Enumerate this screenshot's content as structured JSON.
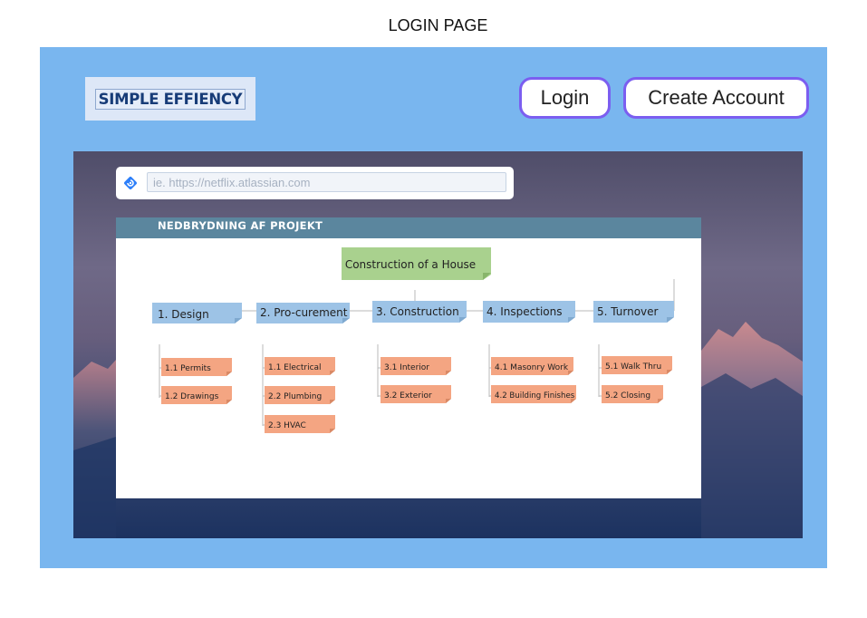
{
  "page": {
    "heading": "LOGIN PAGE"
  },
  "header": {
    "logo_text": "SIMPLE EFFIENCY",
    "login_label": "Login",
    "create_account_label": "Create Account"
  },
  "url_field": {
    "placeholder": "ie. https://netflix.atlassian.com",
    "value": ""
  },
  "document": {
    "title": "NEDBRYDNING AF PROJEKT",
    "root": "Construction of a House",
    "phases": [
      {
        "label": "1. Design",
        "tasks": [
          "1.1 Permits",
          "1.2 Drawings"
        ]
      },
      {
        "label": "2. Pro-curement",
        "tasks": [
          "1.1 Electrical",
          "2.2 Plumbing",
          "2.3 HVAC"
        ]
      },
      {
        "label": "3. Construction",
        "tasks": [
          "3.1 Interior",
          "3.2 Exterior"
        ]
      },
      {
        "label": "4. Inspections",
        "tasks": [
          "4.1 Masonry Work",
          "4.2 Building Finishes"
        ]
      },
      {
        "label": "5. Turnover",
        "tasks": [
          "5.1 Walk Thru",
          "5.2 Closing"
        ]
      }
    ]
  },
  "colors": {
    "frame": "#79b6ef",
    "button_border": "#7b5ef0",
    "doc_header": "#5b869e",
    "root_box": "#a9d18e",
    "phase_box": "#9dc3e6",
    "task_box": "#f4a582"
  },
  "icons": {
    "url_field_icon": "atlassian-diamond-icon"
  }
}
